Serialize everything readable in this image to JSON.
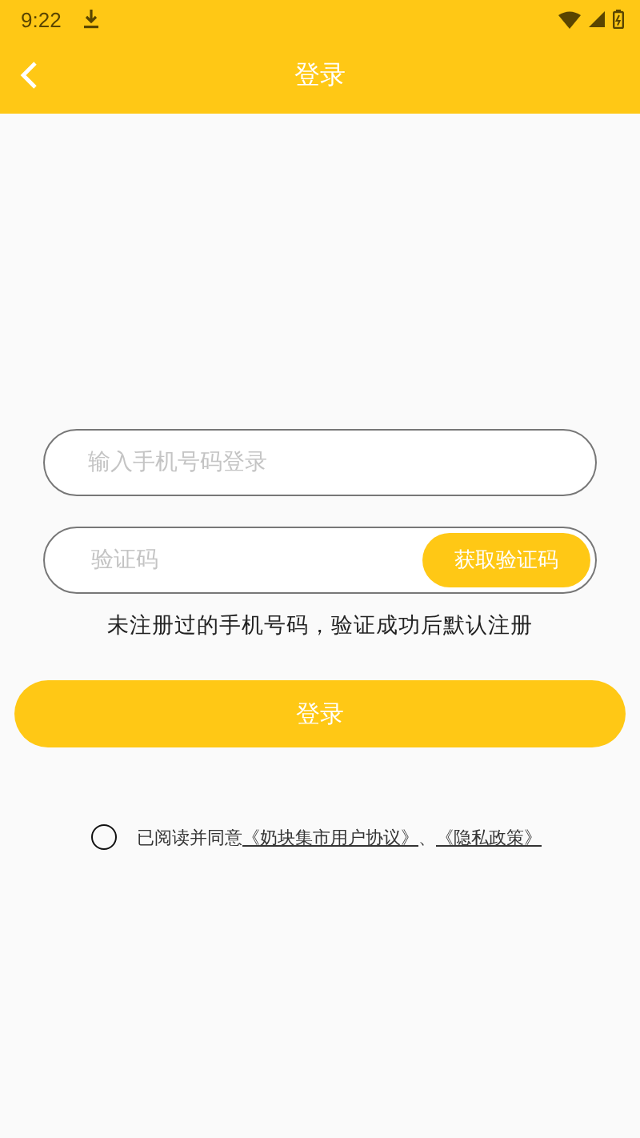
{
  "status_bar": {
    "time": "9:22"
  },
  "header": {
    "title": "登录"
  },
  "phone_field": {
    "placeholder": "输入手机号码登录"
  },
  "code_field": {
    "placeholder": "验证码"
  },
  "get_code_button": {
    "label": "获取验证码"
  },
  "hint": "未注册过的手机号码，验证成功后默认注册",
  "login_button": {
    "label": "登录"
  },
  "agreement": {
    "checked": false,
    "parts": [
      {
        "kind": "text",
        "text": "已阅读并同意"
      },
      {
        "kind": "link",
        "text": "《奶块集市用户协议》"
      },
      {
        "kind": "text",
        "text": "、"
      },
      {
        "kind": "link",
        "text": "《隐私政策》"
      }
    ]
  }
}
